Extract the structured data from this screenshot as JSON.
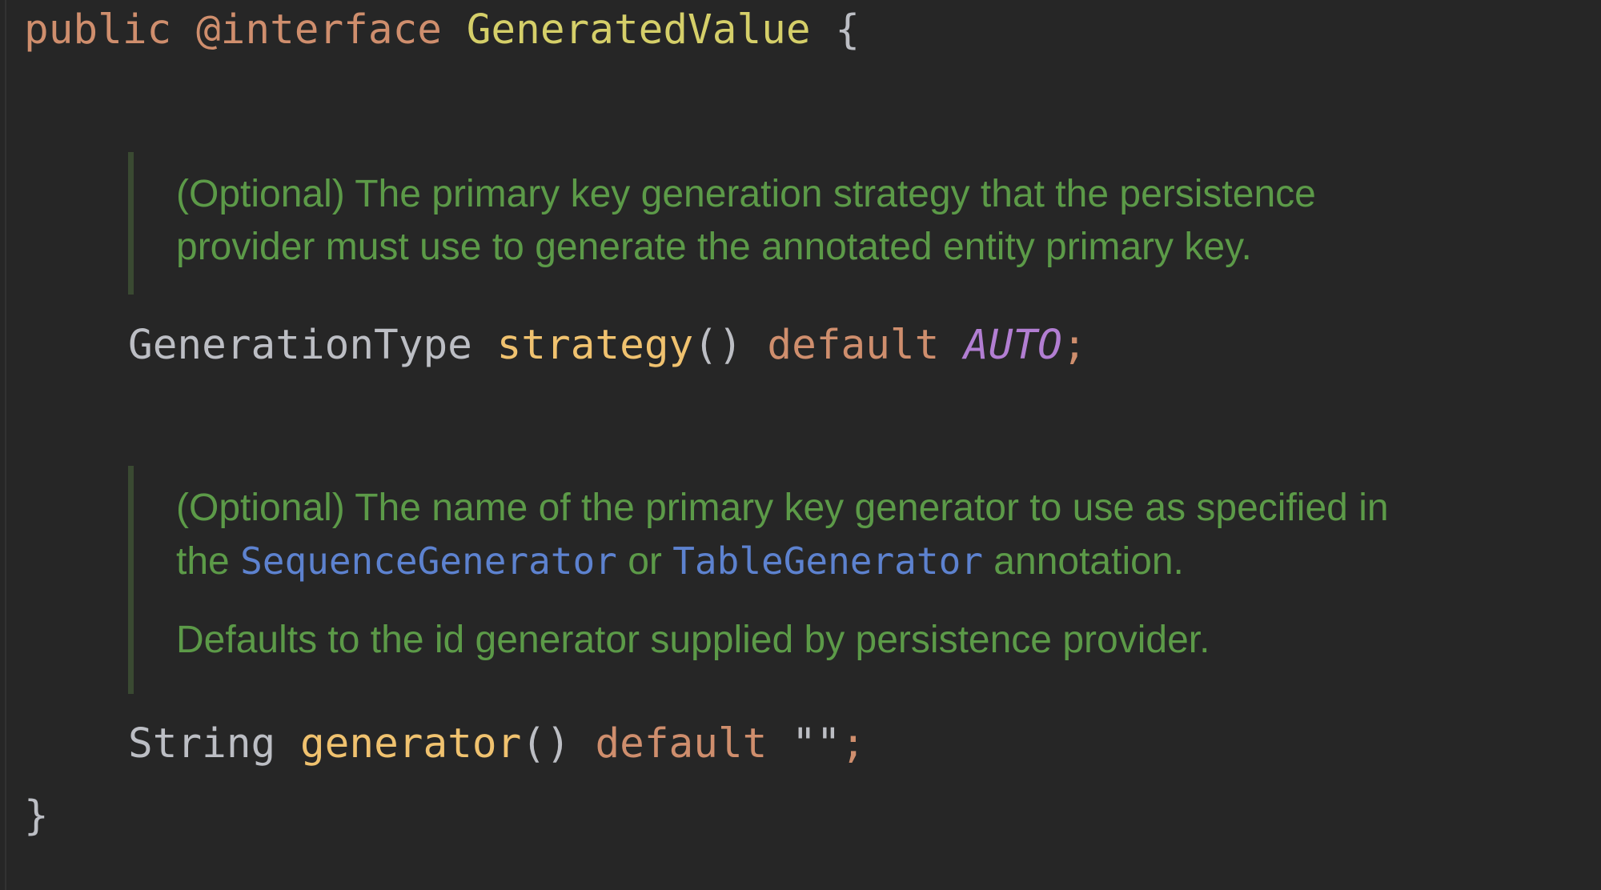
{
  "code": {
    "line1": {
      "public": "public",
      "interface": "@interface",
      "name": "GeneratedValue",
      "brace_open": "{"
    },
    "strategy_line": {
      "type": "GenerationType",
      "method": "strategy",
      "parens": "()",
      "default": "default",
      "value": "AUTO",
      "semicolon": ";"
    },
    "generator_line": {
      "type": "String",
      "method": "generator",
      "parens": "()",
      "default": "default",
      "value": "\"\"",
      "semicolon": ";"
    },
    "brace_close": "}"
  },
  "docs": {
    "strategy": {
      "line1": "(Optional) The primary key generation strategy that the persistence",
      "line2": "provider must use to generate the annotated entity primary key."
    },
    "generator": {
      "line1": "(Optional) The name of the primary key generator to use as specified in",
      "line2_prefix": "the ",
      "link1": "SequenceGenerator",
      "line2_mid": " or ",
      "link2": "TableGenerator",
      "line2_suffix": " annotation.",
      "para2": "Defaults to the id generator supplied by persistence provider."
    }
  },
  "colors": {
    "background": "#262626",
    "keyword": "#cf8e6d",
    "class_name": "#d5cf69",
    "method": "#f0c26f",
    "identifier": "#bcbec4",
    "constant": "#b27ed2",
    "doc_text": "#5c9a48",
    "doc_link": "#5d82cf"
  }
}
